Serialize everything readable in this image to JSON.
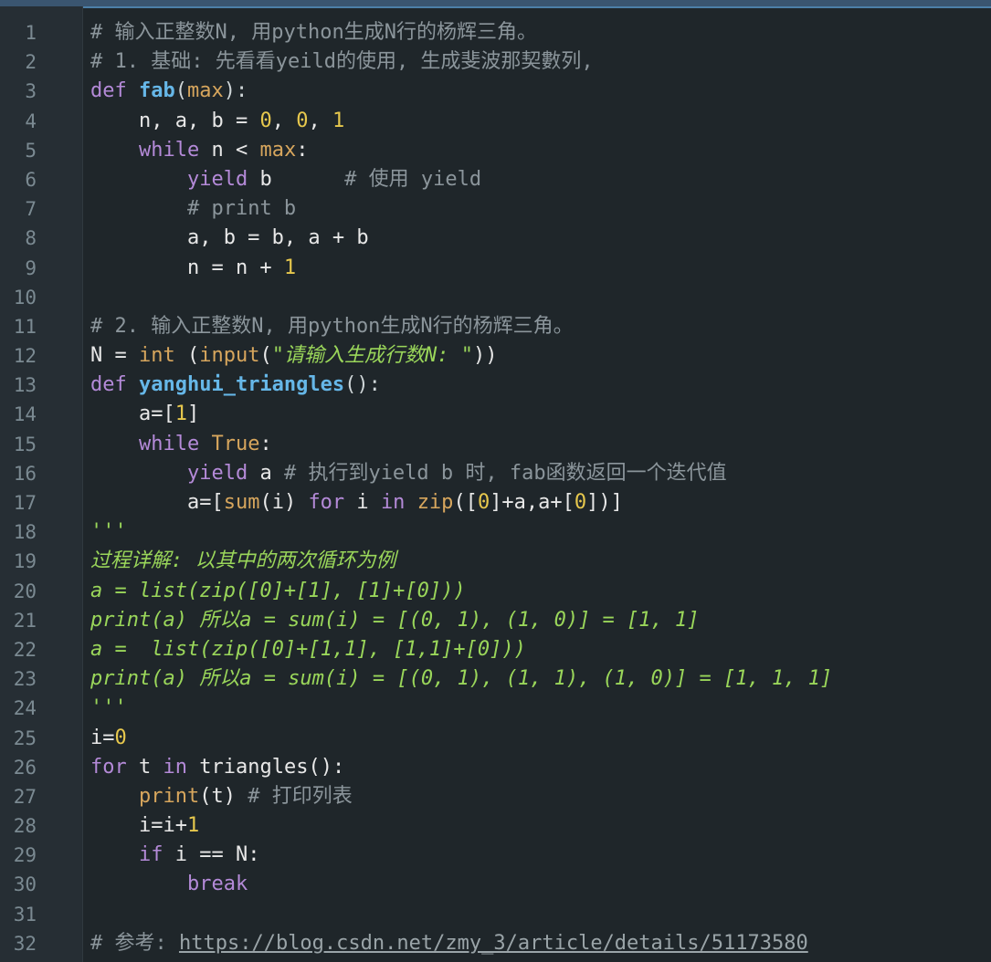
{
  "editor": {
    "lines": [
      {
        "n": "1",
        "tokens": [
          {
            "t": "# 输入正整数N, 用python生成N行的杨辉三角。",
            "c": "cm"
          }
        ]
      },
      {
        "n": "2",
        "tokens": [
          {
            "t": "# 1. 基础: 先看看yeild的使用, 生成斐波那契數列,",
            "c": "cm"
          }
        ]
      },
      {
        "n": "3",
        "tokens": [
          {
            "t": "def ",
            "c": "kw"
          },
          {
            "t": "fab",
            "c": "fn"
          },
          {
            "t": "(",
            "c": "br"
          },
          {
            "t": "max",
            "c": "bi"
          },
          {
            "t": "):",
            "c": "br"
          }
        ]
      },
      {
        "n": "4",
        "tokens": [
          {
            "t": "    n, a, b = ",
            "c": "tx"
          },
          {
            "t": "0",
            "c": "num"
          },
          {
            "t": ", ",
            "c": "tx"
          },
          {
            "t": "0",
            "c": "num"
          },
          {
            "t": ", ",
            "c": "tx"
          },
          {
            "t": "1",
            "c": "num"
          }
        ]
      },
      {
        "n": "5",
        "tokens": [
          {
            "t": "    ",
            "c": "tx"
          },
          {
            "t": "while",
            "c": "kw"
          },
          {
            "t": " n < ",
            "c": "tx"
          },
          {
            "t": "max",
            "c": "bi"
          },
          {
            "t": ":",
            "c": "tx"
          }
        ]
      },
      {
        "n": "6",
        "tokens": [
          {
            "t": "        ",
            "c": "tx"
          },
          {
            "t": "yield",
            "c": "kw"
          },
          {
            "t": " b      ",
            "c": "tx"
          },
          {
            "t": "# 使用 yield",
            "c": "cm"
          }
        ]
      },
      {
        "n": "7",
        "tokens": [
          {
            "t": "        ",
            "c": "tx"
          },
          {
            "t": "# print b",
            "c": "cm"
          }
        ]
      },
      {
        "n": "8",
        "tokens": [
          {
            "t": "        a, b = b, a + b",
            "c": "tx"
          }
        ]
      },
      {
        "n": "9",
        "tokens": [
          {
            "t": "        n = n + ",
            "c": "tx"
          },
          {
            "t": "1",
            "c": "num"
          }
        ]
      },
      {
        "n": "10",
        "tokens": []
      },
      {
        "n": "11",
        "tokens": [
          {
            "t": "# 2. 输入正整数N, 用python生成N行的杨辉三角。",
            "c": "cm"
          }
        ]
      },
      {
        "n": "12",
        "tokens": [
          {
            "t": "N = ",
            "c": "tx"
          },
          {
            "t": "int",
            "c": "bi"
          },
          {
            "t": " (",
            "c": "tx"
          },
          {
            "t": "input",
            "c": "bi"
          },
          {
            "t": "(",
            "c": "tx"
          },
          {
            "t": "\"请输入生成行数N: \"",
            "c": "str"
          },
          {
            "t": "))",
            "c": "tx"
          }
        ]
      },
      {
        "n": "13",
        "tokens": [
          {
            "t": "def ",
            "c": "kw"
          },
          {
            "t": "yanghui_triangles",
            "c": "fn"
          },
          {
            "t": "():",
            "c": "br"
          }
        ]
      },
      {
        "n": "14",
        "tokens": [
          {
            "t": "    a=[",
            "c": "tx"
          },
          {
            "t": "1",
            "c": "num"
          },
          {
            "t": "]",
            "c": "tx"
          }
        ]
      },
      {
        "n": "15",
        "tokens": [
          {
            "t": "    ",
            "c": "tx"
          },
          {
            "t": "while",
            "c": "kw"
          },
          {
            "t": " ",
            "c": "tx"
          },
          {
            "t": "True",
            "c": "bi"
          },
          {
            "t": ":",
            "c": "tx"
          }
        ]
      },
      {
        "n": "16",
        "tokens": [
          {
            "t": "        ",
            "c": "tx"
          },
          {
            "t": "yield",
            "c": "kw"
          },
          {
            "t": " a ",
            "c": "tx"
          },
          {
            "t": "# 执行到yield b 时, fab函数返回一个迭代值",
            "c": "cm"
          }
        ]
      },
      {
        "n": "17",
        "tokens": [
          {
            "t": "        a=[",
            "c": "tx"
          },
          {
            "t": "sum",
            "c": "bi"
          },
          {
            "t": "(i) ",
            "c": "tx"
          },
          {
            "t": "for",
            "c": "kw"
          },
          {
            "t": " i ",
            "c": "tx"
          },
          {
            "t": "in",
            "c": "kw"
          },
          {
            "t": " ",
            "c": "tx"
          },
          {
            "t": "zip",
            "c": "bi"
          },
          {
            "t": "([",
            "c": "tx"
          },
          {
            "t": "0",
            "c": "num"
          },
          {
            "t": "]+a,a+[",
            "c": "tx"
          },
          {
            "t": "0",
            "c": "num"
          },
          {
            "t": "])]",
            "c": "tx"
          }
        ]
      },
      {
        "n": "18",
        "tokens": [
          {
            "t": "'''",
            "c": "doc"
          }
        ]
      },
      {
        "n": "19",
        "tokens": [
          {
            "t": "过程详解: 以其中的两次循环为例",
            "c": "doc"
          }
        ]
      },
      {
        "n": "20",
        "tokens": [
          {
            "t": "a = list(zip([0]+[1], [1]+[0]))",
            "c": "doc"
          }
        ]
      },
      {
        "n": "21",
        "tokens": [
          {
            "t": "print(a) 所以a = sum(i) = [(0, 1), (1, 0)] = [1, 1]",
            "c": "doc"
          }
        ]
      },
      {
        "n": "22",
        "tokens": [
          {
            "t": "a =  list(zip([0]+[1,1], [1,1]+[0]))",
            "c": "doc"
          }
        ]
      },
      {
        "n": "23",
        "tokens": [
          {
            "t": "print(a) 所以a = sum(i) = [(0, 1), (1, 1), (1, 0)] = [1, 1, 1]",
            "c": "doc"
          }
        ]
      },
      {
        "n": "24",
        "tokens": [
          {
            "t": "'''",
            "c": "doc"
          }
        ]
      },
      {
        "n": "25",
        "tokens": [
          {
            "t": "i=",
            "c": "tx"
          },
          {
            "t": "0",
            "c": "num"
          }
        ]
      },
      {
        "n": "26",
        "tokens": [
          {
            "t": "for",
            "c": "kw"
          },
          {
            "t": " t ",
            "c": "tx"
          },
          {
            "t": "in",
            "c": "kw"
          },
          {
            "t": " triangles():",
            "c": "tx"
          }
        ]
      },
      {
        "n": "27",
        "tokens": [
          {
            "t": "    ",
            "c": "tx"
          },
          {
            "t": "print",
            "c": "bi"
          },
          {
            "t": "(t) ",
            "c": "tx"
          },
          {
            "t": "# 打印列表",
            "c": "cm"
          }
        ]
      },
      {
        "n": "28",
        "tokens": [
          {
            "t": "    i=i+",
            "c": "tx"
          },
          {
            "t": "1",
            "c": "num"
          }
        ]
      },
      {
        "n": "29",
        "tokens": [
          {
            "t": "    ",
            "c": "tx"
          },
          {
            "t": "if",
            "c": "kw"
          },
          {
            "t": " i == N:",
            "c": "tx"
          }
        ]
      },
      {
        "n": "30",
        "tokens": [
          {
            "t": "        ",
            "c": "tx"
          },
          {
            "t": "break",
            "c": "kw"
          }
        ]
      },
      {
        "n": "31",
        "tokens": []
      },
      {
        "n": "32",
        "tokens": [
          {
            "t": "# 参考: ",
            "c": "cm"
          },
          {
            "t": "https://blog.csdn.net/zmy_3/article/details/51173580",
            "c": "url"
          }
        ]
      }
    ]
  }
}
